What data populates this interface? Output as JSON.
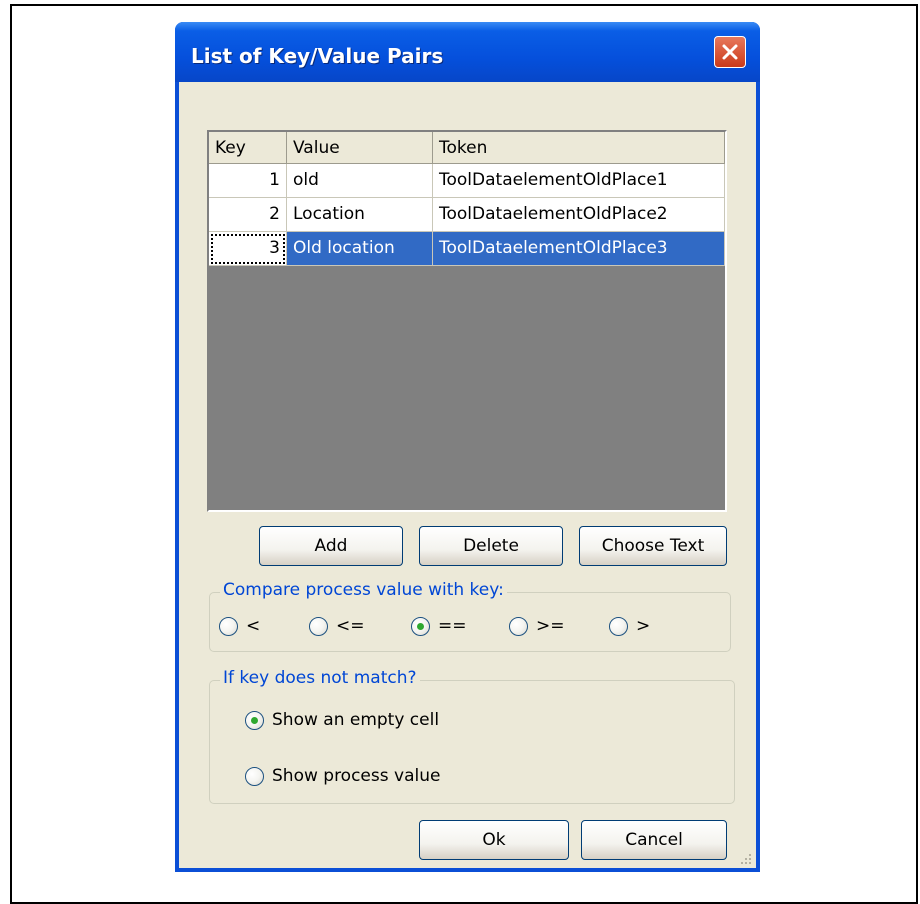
{
  "dialog": {
    "title": "List of Key/Value Pairs"
  },
  "table": {
    "columns": [
      "Key",
      "Value",
      "Token"
    ],
    "rows": [
      {
        "key": "1",
        "value": "old",
        "token": "ToolDataelementOldPlace1"
      },
      {
        "key": "2",
        "value": "Location",
        "token": "ToolDataelementOldPlace2"
      },
      {
        "key": "3",
        "value": "Old location",
        "token": "ToolDataelementOldPlace3"
      }
    ],
    "selected_row": 3
  },
  "buttons": {
    "add": "Add",
    "delete": "Delete",
    "choose_text": "Choose Text",
    "ok": "Ok",
    "cancel": "Cancel"
  },
  "compare_group": {
    "legend": "Compare process value with key:",
    "options": [
      "<",
      "<=",
      "==",
      ">=",
      ">"
    ],
    "selected": "=="
  },
  "mismatch_group": {
    "legend": "If key does not match?",
    "options": [
      "Show an empty cell",
      "Show process value"
    ],
    "selected": "Show an empty cell"
  },
  "colors": {
    "titlebar": "#0550dc",
    "selection": "#316ac5",
    "legend_text": "#0046d5",
    "close_button": "#c93a1a"
  },
  "icons": {
    "close": "close-icon",
    "resize": "resize-grip-icon"
  }
}
